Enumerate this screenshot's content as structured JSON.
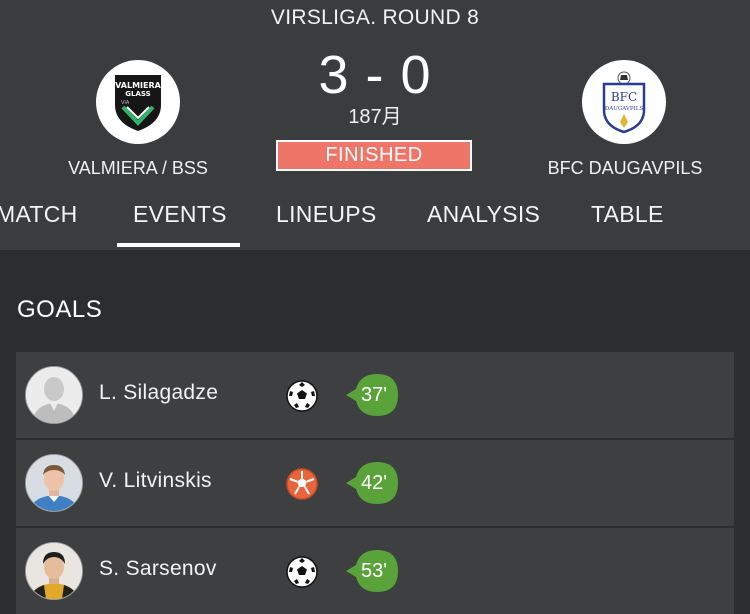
{
  "header": {
    "round_title": "VIRSLIGA. ROUND 8",
    "score": "3 - 0",
    "date": "187月",
    "status": "FINISHED",
    "status_color": "#ef7569",
    "home_team": {
      "name": "VALMIERA / BSS",
      "logo_text": [
        "VALMIERA",
        "GLASS",
        "VIA"
      ]
    },
    "away_team": {
      "name": "BFC DAUGAVPILS",
      "logo_text": [
        "BFC",
        "DAUGAVPILS"
      ]
    }
  },
  "tabs": [
    {
      "label": "MATCH",
      "active": false
    },
    {
      "label": "EVENTS",
      "active": true
    },
    {
      "label": "LINEUPS",
      "active": false
    },
    {
      "label": "ANALYSIS",
      "active": false
    },
    {
      "label": "TABLE",
      "active": false
    }
  ],
  "goals": {
    "title": "GOALS",
    "accent_color": "#5aa33a",
    "items": [
      {
        "player": "L. Silagadze",
        "minute": "37'",
        "ball_icon": "soccer-ball-icon",
        "ball_color": "#111111",
        "avatar": "default-avatar"
      },
      {
        "player": "V. Litvinskis",
        "minute": "42'",
        "ball_icon": "soccer-ball-icon",
        "ball_color": "#e8643a",
        "avatar": "player-photo"
      },
      {
        "player": "S. Sarsenov",
        "minute": "53'",
        "ball_icon": "soccer-ball-icon",
        "ball_color": "#111111",
        "avatar": "player-photo"
      }
    ]
  }
}
